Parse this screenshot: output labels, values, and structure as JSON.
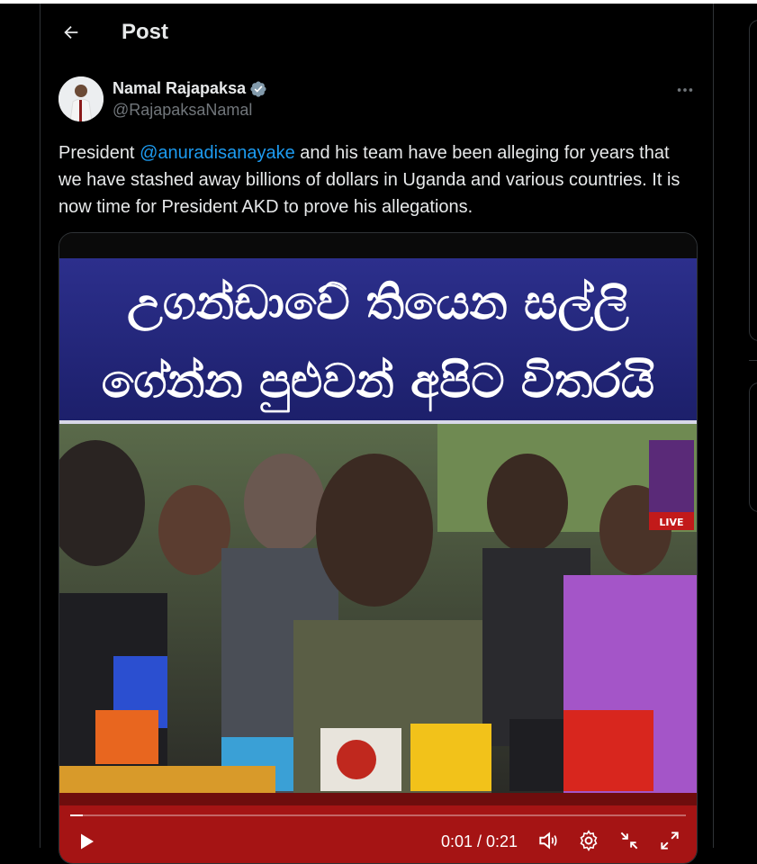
{
  "header": {
    "title": "Post"
  },
  "author": {
    "name": "Namal Rajapaksa",
    "handle": "@RajapaksaNamal",
    "verified": true
  },
  "tweet": {
    "text_before": "President ",
    "mention": "@anuradisanayake",
    "text_after": " and his team have been alleging for years that we have stashed away billions of dollars in Uganda and various countries. It is now time for President AKD to prove his allegations."
  },
  "video": {
    "headline_line1": "උගන්ඩාවේ තියෙන සල්ලි",
    "headline_line2": "ගේන්න පුළුවන් අපිට විතරයි",
    "channel_badge": "LIVE",
    "progress": 0.02,
    "time_display": "0:01 / 0:21"
  },
  "icons": {
    "back": "back-arrow-icon",
    "verified": "verified-badge-icon",
    "more": "more-horizontal-icon",
    "play": "play-icon",
    "volume": "volume-icon",
    "settings": "settings-icon",
    "minimize": "minimize-icon",
    "fullscreen": "fullscreen-icon"
  },
  "colors": {
    "background": "#000000",
    "text": "#e7e9ea",
    "muted": "#71767b",
    "accent": "#1d9bf0",
    "border": "#2f3336",
    "video_banner": "#23267a"
  }
}
